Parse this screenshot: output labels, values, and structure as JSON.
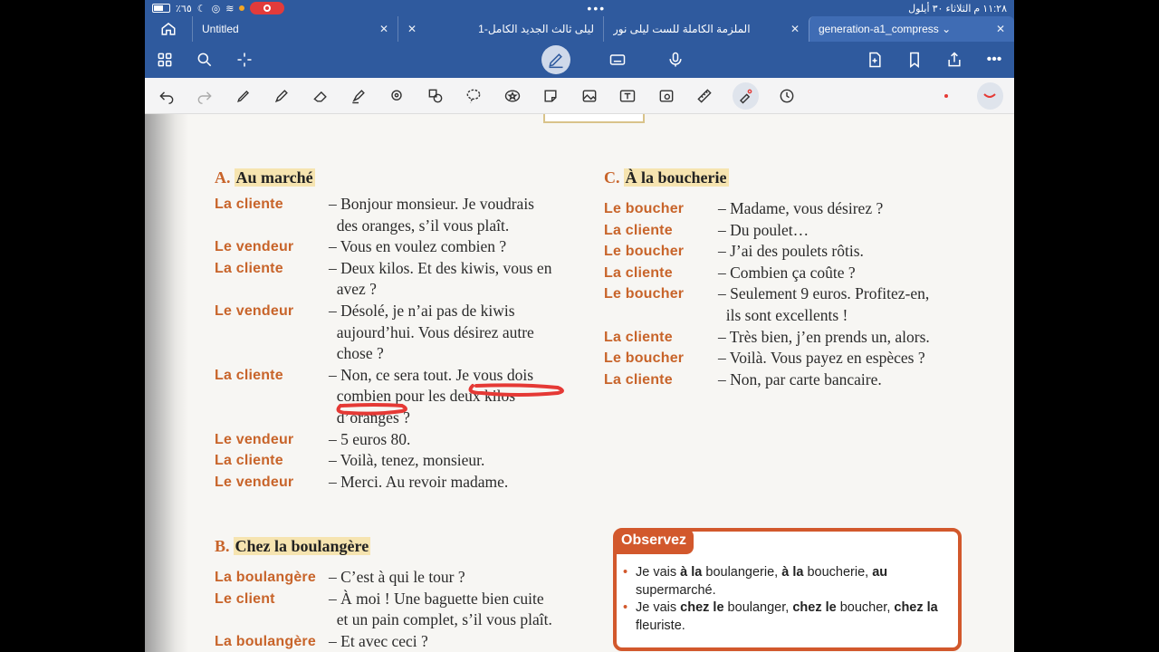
{
  "status": {
    "time_date": "١١:٢٨ م  الثلاثاء ٣٠ أيلول",
    "battery": "٪٦٥"
  },
  "tabs": [
    {
      "label": "Untitled",
      "active": false
    },
    {
      "label": "ليلى ثالث الجديد الكامل-1",
      "active": false
    },
    {
      "label": "الملزمة الكاملة للست ليلى نور",
      "active": false
    },
    {
      "label": "generation-a1_compress",
      "active": true
    }
  ],
  "colors": {
    "chrome": "#2f5a9e",
    "accent": "#c8642a",
    "observe": "#d2582c",
    "ink": "#e53935"
  },
  "sectionA": {
    "letter": "A.",
    "title": "Au marché",
    "lines": [
      {
        "speaker": "La cliente",
        "text": "– Bonjour monsieur. Je voudrais"
      },
      {
        "speaker": "",
        "text": "  des oranges, s’il vous plaît."
      },
      {
        "speaker": "Le vendeur",
        "text": "– Vous en voulez combien ?"
      },
      {
        "speaker": "La cliente",
        "text": "– Deux kilos. Et des kiwis, vous en"
      },
      {
        "speaker": "",
        "text": "  avez ?"
      },
      {
        "speaker": "Le vendeur",
        "text": "– Désolé, je n’ai pas de kiwis"
      },
      {
        "speaker": "",
        "text": "  aujourd’hui. Vous désirez autre"
      },
      {
        "speaker": "",
        "text": "  chose ?"
      },
      {
        "speaker": "La cliente",
        "text": "– Non, ce sera tout. Je vous dois"
      },
      {
        "speaker": "",
        "text": "  combien pour les deux kilos"
      },
      {
        "speaker": "",
        "text": "  d’oranges ?"
      },
      {
        "speaker": "Le vendeur",
        "text": "– 5 euros 80."
      },
      {
        "speaker": "La cliente",
        "text": "– Voilà, tenez, monsieur."
      },
      {
        "speaker": "Le vendeur",
        "text": "– Merci. Au revoir madame."
      }
    ]
  },
  "sectionB": {
    "letter": "B.",
    "title": "Chez la boulangère",
    "lines": [
      {
        "speaker": "La boulangère",
        "text": "– C’est à qui le tour ?"
      },
      {
        "speaker": "Le client",
        "text": "– À moi ! Une baguette bien cuite"
      },
      {
        "speaker": "",
        "text": "  et un pain complet, s’il vous plaît."
      },
      {
        "speaker": "La boulangère",
        "text": "– Et avec ceci ?"
      }
    ]
  },
  "sectionC": {
    "letter": "C.",
    "title": "À la boucherie",
    "lines": [
      {
        "speaker": "Le boucher",
        "text": "– Madame, vous désirez ?"
      },
      {
        "speaker": "La cliente",
        "text": "– Du poulet…"
      },
      {
        "speaker": "Le boucher",
        "text": "– J’ai des poulets rôtis."
      },
      {
        "speaker": "La cliente",
        "text": "– Combien ça coûte ?"
      },
      {
        "speaker": "Le boucher",
        "text": "– Seulement 9 euros. Profitez-en,"
      },
      {
        "speaker": "",
        "text": "  ils sont excellents !"
      },
      {
        "speaker": "La cliente",
        "text": "– Très bien, j’en prends un, alors."
      },
      {
        "speaker": "Le boucher",
        "text": "– Voilà. Vous payez en espèces ?"
      },
      {
        "speaker": "La cliente",
        "text": "– Non, par carte bancaire."
      }
    ]
  },
  "observez": {
    "title": "Observez",
    "items": [
      {
        "parts": [
          [
            "Je vais ",
            false
          ],
          [
            "à la",
            true
          ],
          [
            " boulangerie, ",
            false
          ],
          [
            "à la",
            true
          ],
          [
            " boucherie, ",
            false
          ],
          [
            "au",
            true
          ],
          [
            " supermarché.",
            false
          ]
        ]
      },
      {
        "parts": [
          [
            "Je vais ",
            false
          ],
          [
            "chez le",
            true
          ],
          [
            " boulanger, ",
            false
          ],
          [
            "chez le",
            true
          ],
          [
            " boucher, ",
            false
          ],
          [
            "chez la",
            true
          ],
          [
            " fleuriste.",
            false
          ]
        ]
      }
    ]
  }
}
